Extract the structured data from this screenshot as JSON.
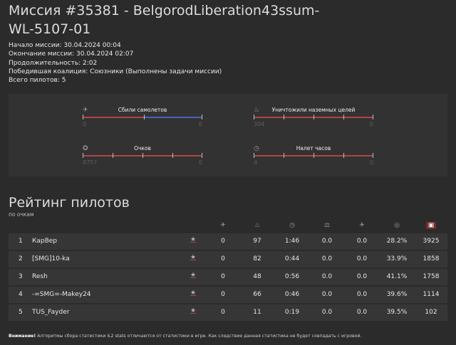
{
  "page": {
    "title": "Миссия #35381 - BelgorodLiberation43ssum-WL-5107-01"
  },
  "meta": [
    "Начало миссии: 30.04.2024 00:04",
    "Окончание миссии: 30.04.2024 02:07",
    "Продолжительность: 2:02",
    "Победившая коалиция: Союзники (Выполнены задачи миссии)",
    "Всего пилотов: 5"
  ],
  "stats": [
    {
      "label": "Сбили самолетов",
      "left": "0",
      "right": "0",
      "icon": "plane-icon",
      "glyph": "✈"
    },
    {
      "label": "Уничтожили наземных целей",
      "left": "304",
      "right": "0",
      "icon": "fire-icon",
      "glyph": "♨"
    },
    {
      "label": "Очков",
      "left": "8757",
      "right": "0",
      "icon": "medal-icon",
      "glyph": "✪"
    },
    {
      "label": "Налет часов",
      "left": "4",
      "right": "0",
      "icon": "clock-icon",
      "glyph": "◷"
    }
  ],
  "ranking": {
    "title": "Рейтинг пилотов",
    "subtitle": "по очкам",
    "header_icons": [
      {
        "name": "plane-icon",
        "glyph": "✈"
      },
      {
        "name": "fire-icon",
        "glyph": "♨"
      },
      {
        "name": "clock-icon",
        "glyph": "◷"
      },
      {
        "name": "scales-icon",
        "glyph": "⚖"
      },
      {
        "name": "plane-kill-icon",
        "glyph": "✈"
      },
      {
        "name": "target-icon",
        "glyph": "◎"
      },
      {
        "name": "score-icon",
        "glyph": "▣"
      }
    ],
    "rows": [
      {
        "num": "1",
        "name": "КарВер",
        "star": "★",
        "kills": "0",
        "ground": "97",
        "time": "1:46",
        "ratio1": "0.0",
        "ratio2": "0.0",
        "accuracy": "28.2%",
        "score": "3925"
      },
      {
        "num": "2",
        "name": "[SMG]10-ka",
        "star": "★",
        "kills": "0",
        "ground": "82",
        "time": "0:44",
        "ratio1": "0.0",
        "ratio2": "0.0",
        "accuracy": "33.9%",
        "score": "1858"
      },
      {
        "num": "3",
        "name": "Resh",
        "star": "★",
        "kills": "0",
        "ground": "48",
        "time": "0:56",
        "ratio1": "0.0",
        "ratio2": "0.0",
        "accuracy": "41.1%",
        "score": "1758"
      },
      {
        "num": "4",
        "name": "-=SMG=-Makey24",
        "star": "★",
        "kills": "0",
        "ground": "66",
        "time": "0:46",
        "ratio1": "0.0",
        "ratio2": "0.0",
        "accuracy": "39.6%",
        "score": "1114"
      },
      {
        "num": "5",
        "name": "TUS_Fayder",
        "star": "★",
        "kills": "0",
        "ground": "11",
        "time": "0:19",
        "ratio1": "0.0",
        "ratio2": "0.0",
        "accuracy": "39.5%",
        "score": "102"
      }
    ]
  },
  "footer": {
    "warning": "Внимание!",
    "text": " Алгоритмы сбора статистики IL2 stats отличаются от статистики в игре. Как следствие данная статистика не будет совпадать с игровой."
  }
}
